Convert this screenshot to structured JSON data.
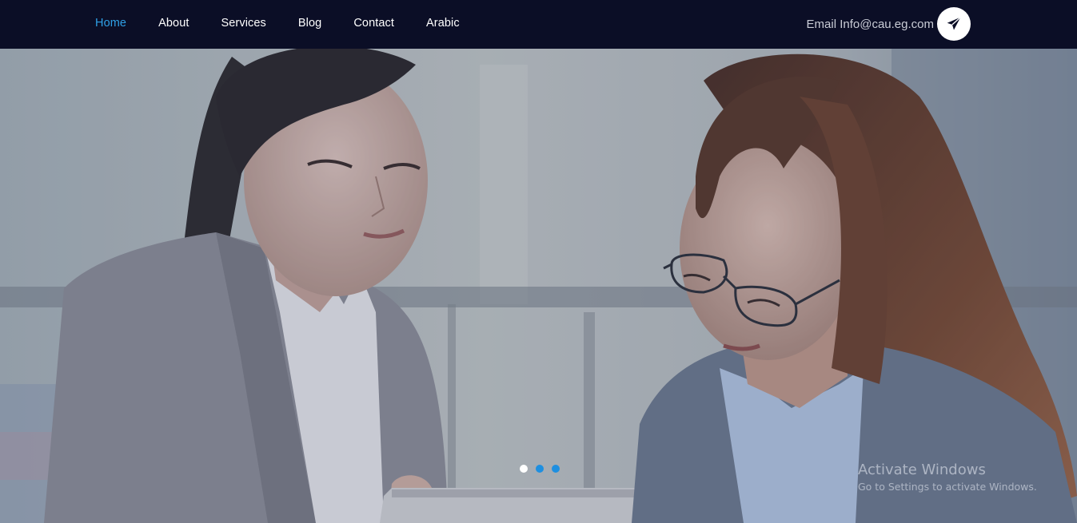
{
  "nav": {
    "items": [
      {
        "label": "Home",
        "active": true
      },
      {
        "label": "About",
        "active": false
      },
      {
        "label": "Services",
        "active": false
      },
      {
        "label": "Blog",
        "active": false
      },
      {
        "label": "Contact",
        "active": false
      },
      {
        "label": "Arabic",
        "active": false
      }
    ]
  },
  "contact": {
    "email_label": "Email Info@cau.eg.com",
    "send_icon": "paper-plane-icon"
  },
  "hero": {
    "image": "two businesswomen looking at a tablet",
    "slides_total": 3,
    "active_slide": 1
  },
  "watermark": {
    "title": "Activate Windows",
    "subtitle": "Go to Settings to activate Windows."
  },
  "colors": {
    "navbar_bg": "#0b0e26",
    "nav_active": "#2fa0e6",
    "dot": "#1e8fe0",
    "dot_active": "#ffffff"
  }
}
